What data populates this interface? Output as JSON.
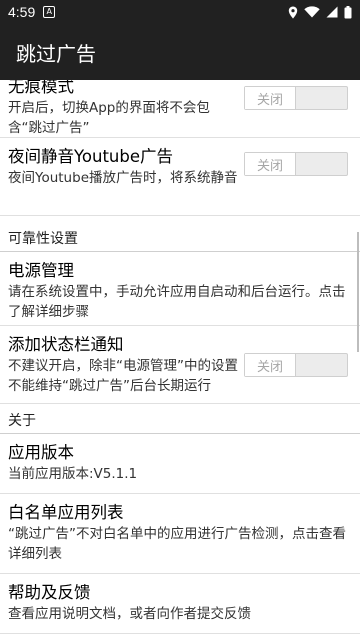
{
  "status_bar": {
    "time": "4:59",
    "left_icon": "A",
    "icons": [
      "location-icon",
      "wifi-icon",
      "signal-icon",
      "battery-icon"
    ]
  },
  "app_bar": {
    "title": "跳过广告"
  },
  "prefs": {
    "no_trace": {
      "title": "无痕模式",
      "summary": "开启后，切换App的界面将不会包含“跳过广告”",
      "toggle": "关闭"
    },
    "night_mute": {
      "title": "夜间静音Youtube广告",
      "summary": "夜间Youtube播放广告时，将系统静音",
      "toggle": "关闭"
    },
    "reliability_header": "可靠性设置",
    "power": {
      "title": "电源管理",
      "summary": "请在系统设置中，手动允许应用自启动和后台运行。点击了解详细步骤"
    },
    "statusbar_notify": {
      "title": "添加状态栏通知",
      "summary": "不建议开启，除非“电源管理”中的设置不能维持“跳过广告”后台长期运行",
      "toggle": "关闭"
    },
    "about_header": "关于",
    "version": {
      "title": "应用版本",
      "summary": "当前应用版本:V5.1.1"
    },
    "whitelist": {
      "title": "白名单应用列表",
      "summary": "“跳过广告”不对白名单中的应用进行广告检测，点击查看详细列表"
    },
    "help": {
      "title": "帮助及反馈",
      "summary": "查看应用说明文档，或者向作者提交反馈"
    }
  },
  "colors": {
    "bar": "#212121",
    "toggle_off": "#ececec"
  }
}
